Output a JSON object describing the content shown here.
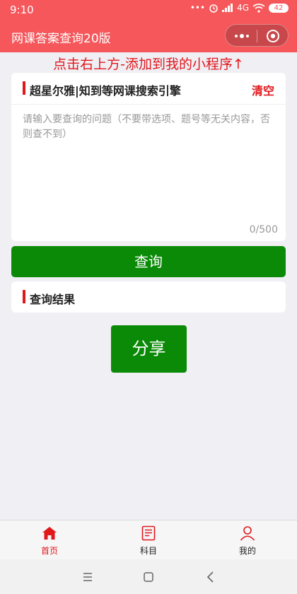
{
  "status": {
    "time": "9:10",
    "signal_text": "4G",
    "battery": "42"
  },
  "navbar": {
    "title": "网课答案查询20版"
  },
  "tip": "点击右上方-添加到我的小程序↑",
  "search_card": {
    "title": "超星尔雅|知到等网课搜索引擎",
    "clear_label": "清空",
    "placeholder": "请输入要查询的问题（不要带选项、题号等无关内容，否则查不到）",
    "value": "",
    "counter": "0/500"
  },
  "query_button": "查询",
  "result_card": {
    "title": "查询结果"
  },
  "share_button": "分享",
  "tabs": [
    {
      "label": "首页",
      "icon": "home-icon",
      "active": true
    },
    {
      "label": "科目",
      "icon": "book-icon",
      "active": false
    },
    {
      "label": "我的",
      "icon": "user-icon",
      "active": false
    }
  ],
  "colors": {
    "accent": "#f5575b",
    "highlight": "#e0181c",
    "button": "#0a8a07"
  }
}
